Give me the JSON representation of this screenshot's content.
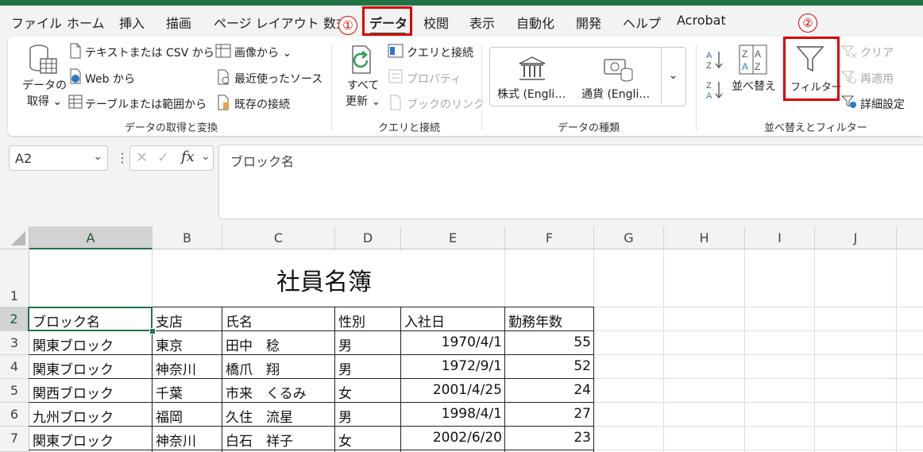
{
  "menu": {
    "tabs": [
      "ファイル",
      "ホーム",
      "挿入",
      "描画",
      "ページ レイアウト",
      "数式",
      "データ",
      "校閲",
      "表示",
      "自動化",
      "開発",
      "ヘルプ",
      "Acrobat"
    ],
    "active_tab": "データ",
    "annotations": [
      "①",
      "②"
    ],
    "highlight_color": "#d80000"
  },
  "ribbon": {
    "get_transform": {
      "get_data": [
        "データの",
        "取得 ⌄"
      ],
      "text_csv": "テキストまたは CSV から",
      "web": "Web から",
      "table_range": "テーブルまたは範囲から",
      "from_image": "画像から ⌄",
      "recent_sources": "最近使ったソース",
      "existing_conn": "既存の接続",
      "group_label": "データの取得と変換"
    },
    "queries": {
      "refresh_all": [
        "すべて",
        "更新 ⌄"
      ],
      "queries_conn": "クエリと接続",
      "properties": "プロパティ",
      "edit_links": "ブックのリンク",
      "group_label": "クエリと接続"
    },
    "data_types": {
      "stocks": "株式 (Engli…",
      "currencies": "通貨 (Engli…",
      "more": "⌄",
      "group_label": "データの種類"
    },
    "sort_filter": {
      "sort": "並べ替え",
      "filter": "フィルター",
      "clear": "クリア",
      "reapply": "再適用",
      "advanced": "詳細設定",
      "group_label": "並べ替えとフィルター"
    }
  },
  "formula_bar": {
    "name_box": "A2",
    "fx": "fx",
    "content": "ブロック名"
  },
  "sheet": {
    "columns": [
      "A",
      "B",
      "C",
      "D",
      "E",
      "F",
      "G",
      "H",
      "I",
      "J"
    ],
    "rows": [
      "1",
      "2",
      "3",
      "4",
      "5",
      "6",
      "7"
    ],
    "title": "社員名簿",
    "headers": [
      "ブロック名",
      "支店",
      "氏名",
      "性別",
      "入社日",
      "勤務年数"
    ],
    "data": [
      [
        "関東ブロック",
        "東京",
        "田中　稔",
        "男",
        "1970/4/1",
        "55"
      ],
      [
        "関東ブロック",
        "神奈川",
        "橋爪　翔",
        "男",
        "1972/9/1",
        "52"
      ],
      [
        "関西ブロック",
        "千葉",
        "市来　くるみ",
        "女",
        "2001/4/25",
        "24"
      ],
      [
        "九州ブロック",
        "福岡",
        "久住　流星",
        "男",
        "1998/4/1",
        "27"
      ],
      [
        "関東ブロック",
        "神奈川",
        "白石　祥子",
        "女",
        "2002/6/20",
        "23"
      ]
    ]
  }
}
